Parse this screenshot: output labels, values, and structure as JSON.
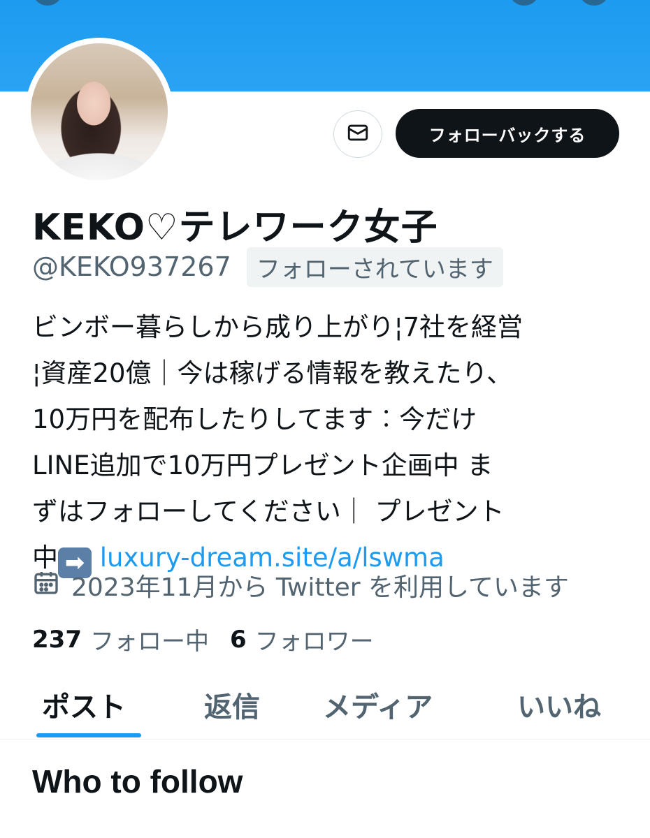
{
  "profile": {
    "display_name": "KEKO♡テレワーク女子",
    "handle": "@KEKO937267",
    "follows_you_badge": "フォローされています",
    "follow_back_label": "フォローバックする",
    "bio_text": "ビンボー暮らしから成り上がり¦7社を経営\n¦資産20億｜今は稼げる情報を教えたり、\n10万円を配布したりしてます︰今だけ\nLINE追加で10万円プレゼント企画中 ま\nずはフォローしてください｜ プレゼント\n中",
    "bio_arrow_emoji": "➡",
    "bio_link": "luxury-dream.site/a/lswma",
    "joined_text": "2023年11月から Twitter を利用しています",
    "following_count": "237",
    "following_label": "フォロー中",
    "followers_count": "6",
    "followers_label": "フォロワー"
  },
  "icons": {
    "mail": "envelope-icon",
    "calendar": "calendar-icon"
  },
  "tabs": [
    {
      "label": "ポスト",
      "active": true
    },
    {
      "label": "返信",
      "active": false
    },
    {
      "label": "メディア",
      "active": false
    },
    {
      "label": "いいね",
      "active": false
    }
  ],
  "section": {
    "who_to_follow": "Who to follow"
  },
  "colors": {
    "banner": "#1d9bf0",
    "link": "#1d9bf0",
    "primary_button": "#0f1419",
    "secondary_text": "#536471"
  }
}
